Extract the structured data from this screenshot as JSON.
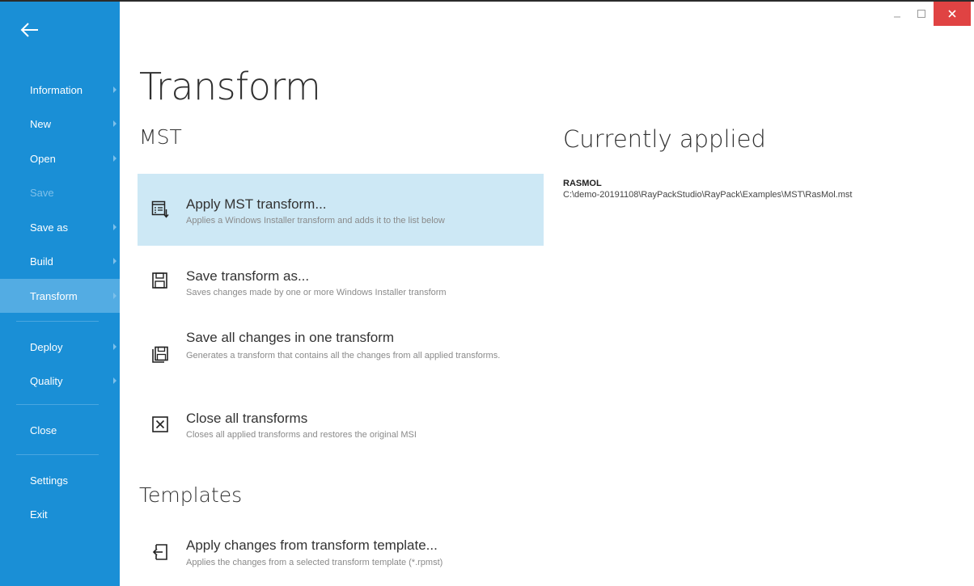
{
  "sidebar": {
    "items": [
      {
        "label": "Information",
        "disabled": false
      },
      {
        "label": "New",
        "disabled": false
      },
      {
        "label": "Open",
        "disabled": false
      },
      {
        "label": "Save",
        "disabled": true
      },
      {
        "label": "Save as",
        "disabled": false
      },
      {
        "label": "Build",
        "disabled": false
      },
      {
        "label": "Transform",
        "active": true
      },
      {
        "label": "Deploy"
      },
      {
        "label": "Quality"
      },
      {
        "label": "Close"
      },
      {
        "label": "Settings"
      },
      {
        "label": "Exit"
      }
    ]
  },
  "window": {
    "minimize_icon": "minimize-icon",
    "maximize_icon": "maximize-icon",
    "close_icon": "close-icon",
    "close_color": "#e04343"
  },
  "main": {
    "title": "Transform",
    "mst_section": "MST",
    "templates_section": "Templates",
    "actions": [
      {
        "label": "Apply MST transform...",
        "desc": "Applies a Windows Installer transform and adds it to the list below",
        "icon": "apply-transform-icon"
      },
      {
        "label": "Save transform as...",
        "desc": "Saves changes made by one or more Windows Installer transform",
        "icon": "save-icon"
      },
      {
        "label": "Save all changes in one transform",
        "desc": "Generates a transform that contains all the changes from all applied transforms.",
        "icon": "save-all-icon"
      },
      {
        "label": "Close all transforms",
        "desc": "Closes all applied transforms and restores the original MSI",
        "icon": "close-box-icon"
      },
      {
        "label": "Apply changes from transform template...",
        "desc": "Applies the changes from a selected transform template (*.rpmst)",
        "icon": "import-icon"
      }
    ]
  },
  "applied": {
    "title": "Currently applied",
    "items": [
      {
        "name": "RASMOL",
        "path": "C:\\demo-20191108\\RayPackStudio\\RayPack\\Examples\\MST\\RasMol.mst"
      }
    ]
  },
  "colors": {
    "sidebar": "#1a8fd6",
    "sidebar_active": "#53ace3",
    "highlight": "#cde8f5"
  }
}
